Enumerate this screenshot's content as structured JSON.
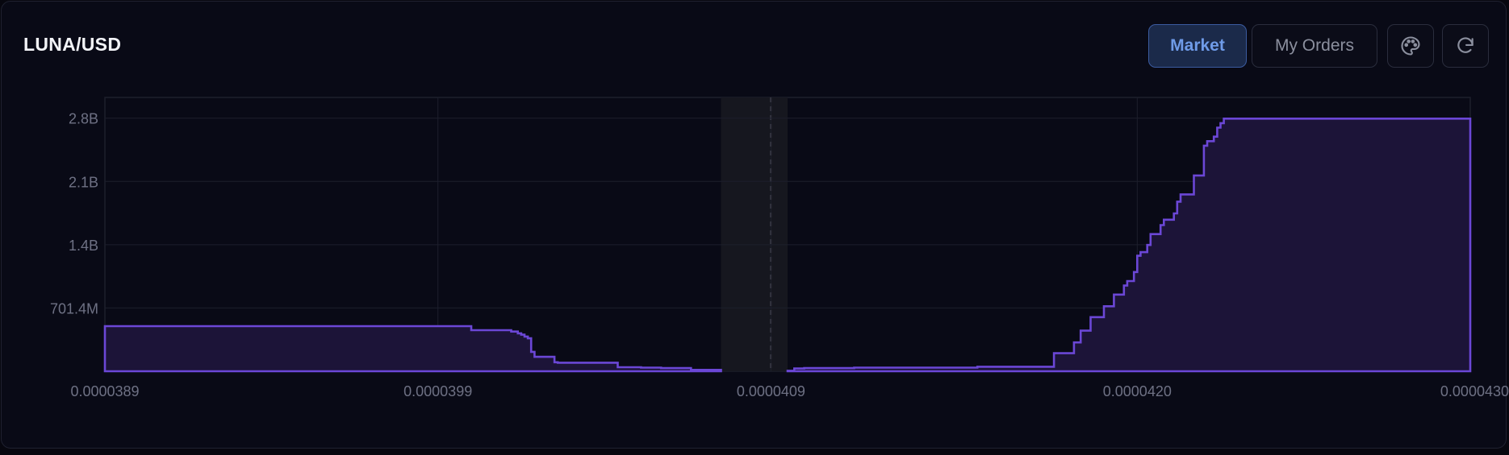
{
  "header": {
    "pair": "LUNA/USD",
    "tabs": [
      {
        "label": "Market",
        "active": true
      },
      {
        "label": "My Orders",
        "active": false
      }
    ],
    "icons": [
      "palette-icon",
      "refresh-icon"
    ]
  },
  "colors": {
    "accent": "#6b47d6",
    "fill": "#1c1438",
    "grid": "#1d1f2c",
    "tick": "#6e7184",
    "spread": "#16171f",
    "midline": "#8a8a96"
  },
  "chart_data": {
    "type": "area",
    "title": "",
    "xlabel": "",
    "ylabel": "",
    "xlim": [
      3.89e-05,
      4.3e-05
    ],
    "ylim": [
      0,
      3035000000.0
    ],
    "x_tick_labels": [
      "0.0000389",
      "0.0000399",
      "0.0000409",
      "0.0000420",
      "0.0000430"
    ],
    "x_tick_values": [
      3.89e-05,
      3.99e-05,
      4.09e-05,
      4.2e-05,
      4.3e-05
    ],
    "y_tick_labels": [
      "701.4M",
      "1.4B",
      "2.1B",
      "2.8B"
    ],
    "y_tick_values": [
      701400000,
      1402800000,
      2104200000,
      2805600000
    ],
    "mid_price": 4.09e-05,
    "spread": [
      4.075e-05,
      4.095e-05
    ],
    "grid": true,
    "series": [
      {
        "side": "bids",
        "step": true,
        "x": [
          3.89e-05,
          3.997e-05,
          4e-05,
          4.012e-05,
          4.014e-05,
          4.015e-05,
          4.016e-05,
          4.017e-05,
          4.018e-05,
          4.019e-05,
          4.02e-05,
          4.025e-05,
          4.026e-05,
          4.044e-05,
          4.051e-05,
          4.057e-05,
          4.066e-05,
          4.075e-05
        ],
        "y": [
          500000000,
          500000000,
          455000000,
          440000000,
          420000000,
          405000000,
          385000000,
          365000000,
          215000000,
          160000000,
          160000000,
          100000000,
          95000000,
          45000000,
          40000000,
          35000000,
          15000000,
          5000000
        ]
      },
      {
        "side": "asks",
        "step": true,
        "x": [
          4.095e-05,
          4.097e-05,
          4.1e-05,
          4.115e-05,
          4.152e-05,
          4.175e-05,
          4.181e-05,
          4.183e-05,
          4.186e-05,
          4.19e-05,
          4.193e-05,
          4.196e-05,
          4.197e-05,
          4.199e-05,
          4.2e-05,
          4.201e-05,
          4.203e-05,
          4.204e-05,
          4.207e-05,
          4.208e-05,
          4.211e-05,
          4.212e-05,
          4.213e-05,
          4.217e-05,
          4.22e-05,
          4.221e-05,
          4.223e-05,
          4.224e-05,
          4.225e-05,
          4.226e-05,
          4.3e-05
        ],
        "y": [
          5000000,
          30000000,
          35000000,
          40000000,
          50000000,
          200000000,
          320000000,
          450000000,
          600000000,
          720000000,
          850000000,
          950000000,
          1000000000,
          1100000000,
          1280000000,
          1320000000,
          1400000000,
          1520000000,
          1620000000,
          1680000000,
          1750000000,
          1880000000,
          1960000000,
          2170000000,
          2500000000,
          2550000000,
          2600000000,
          2700000000,
          2750000000,
          2800000000,
          2800000000
        ]
      }
    ]
  }
}
